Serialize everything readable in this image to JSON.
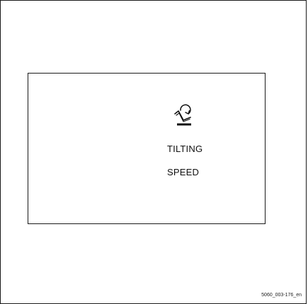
{
  "display": {
    "icon": "tilting-speed-icon",
    "line1": "TILTING",
    "line2": "SPEED"
  },
  "figure_id": "5060_003-176_en",
  "colors": {
    "border": "#1a1a1a",
    "text": "#111111",
    "background": "#ffffff"
  }
}
